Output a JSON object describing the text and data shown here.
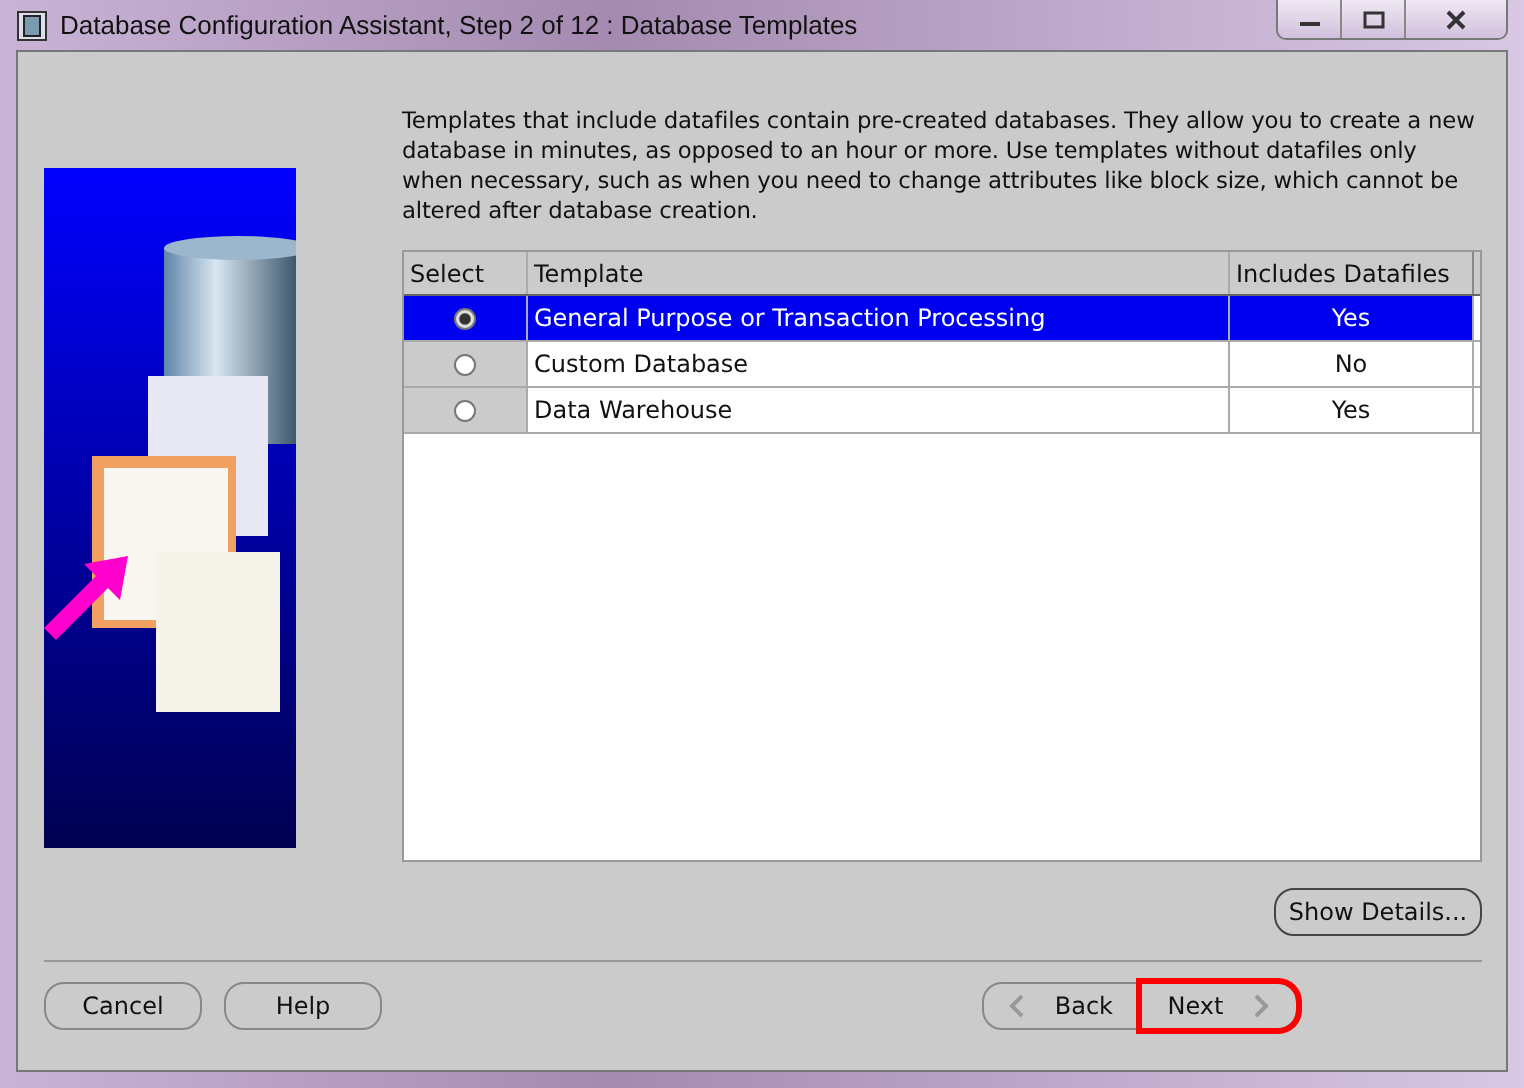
{
  "window": {
    "title": "Database Configuration Assistant, Step 2 of 12 : Database Templates"
  },
  "description": "Templates that include datafiles contain pre-created databases. They allow you to create a new database in minutes, as opposed to an hour or more. Use templates without datafiles only when necessary, such as when you need to change attributes like block size, which cannot be altered after database creation.",
  "table": {
    "columns": [
      "Select",
      "Template",
      "Includes Datafiles"
    ],
    "rows": [
      {
        "template": "General Purpose or Transaction Processing",
        "includes_datafiles": "Yes",
        "selected": true
      },
      {
        "template": "Custom Database",
        "includes_datafiles": "No",
        "selected": false
      },
      {
        "template": "Data Warehouse",
        "includes_datafiles": "Yes",
        "selected": false
      }
    ]
  },
  "show_details_button": "Show Details...",
  "left_buttons": [
    "Cancel",
    "Help"
  ],
  "nav_buttons": [
    {
      "label": "Back",
      "kind": "back",
      "highlighted": false
    },
    {
      "label": "Next",
      "kind": "next",
      "highlighted": true
    }
  ]
}
